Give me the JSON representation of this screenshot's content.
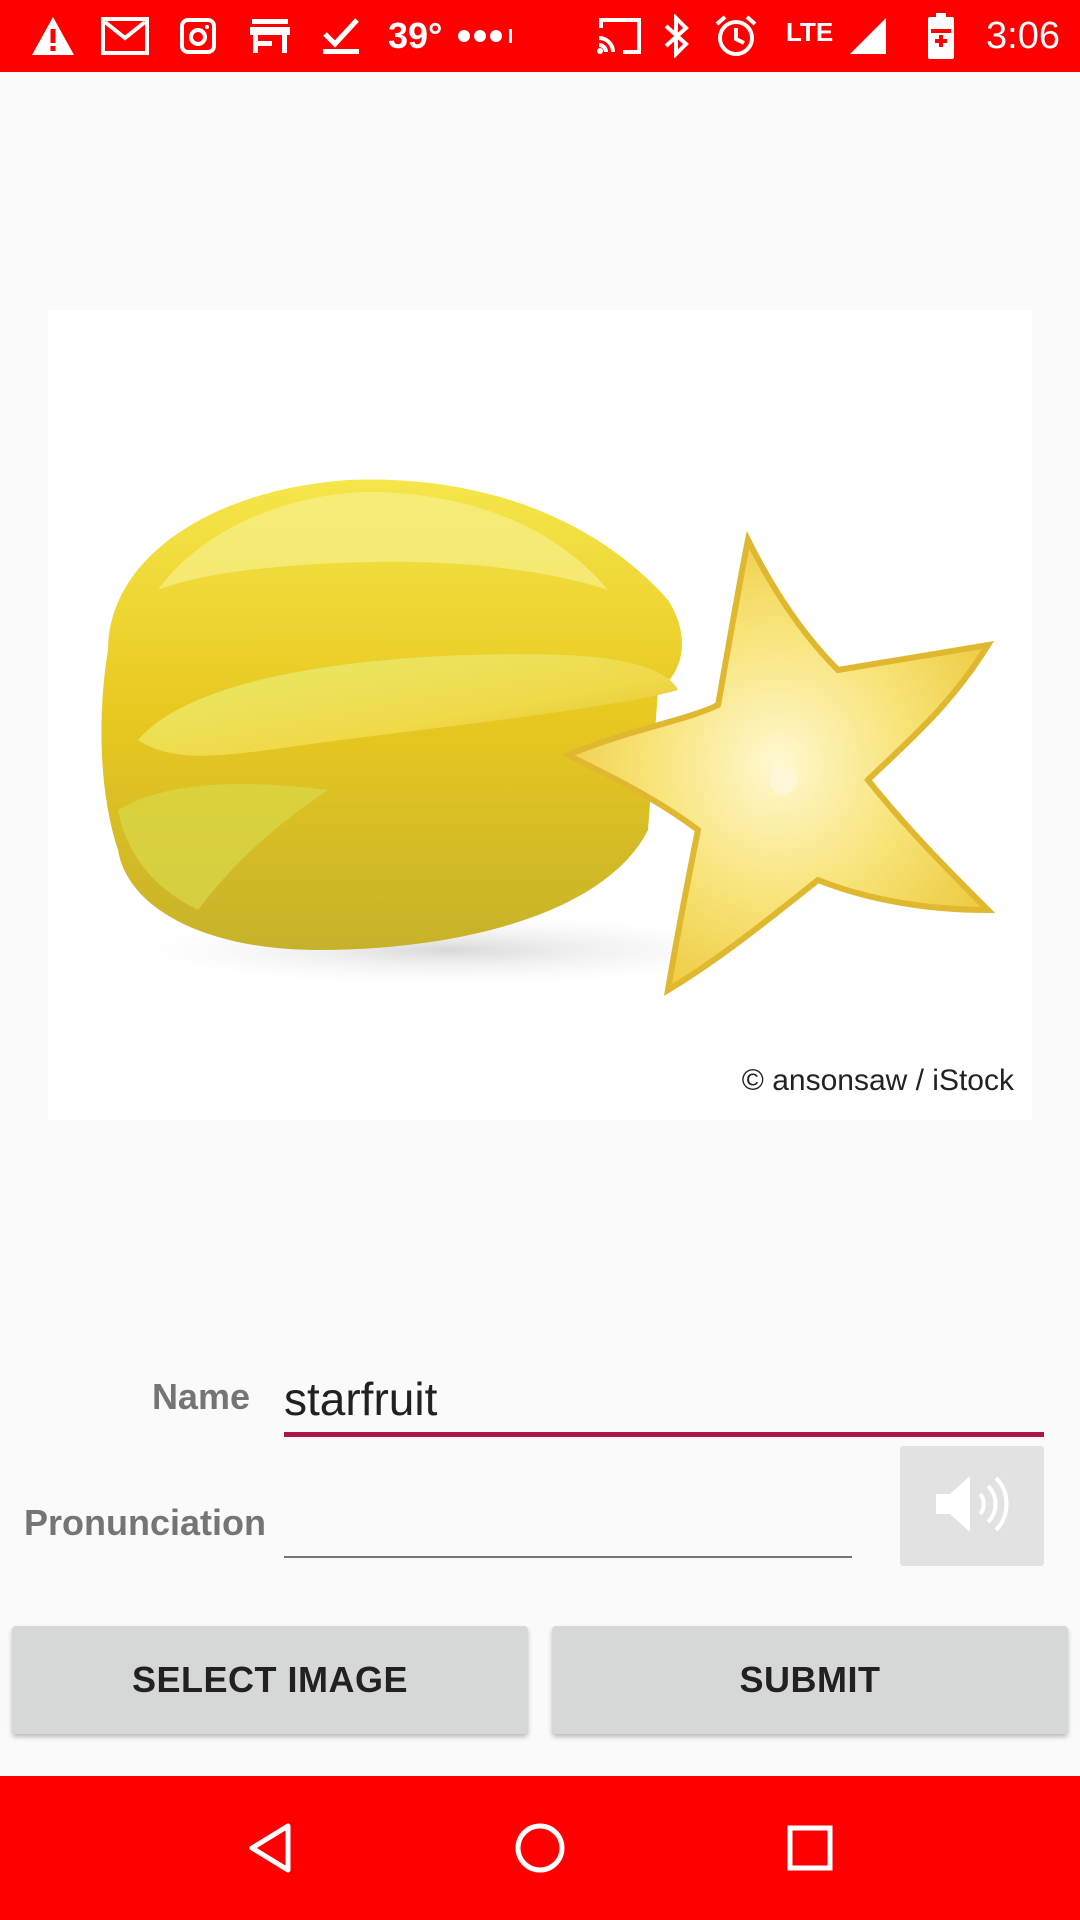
{
  "status_bar": {
    "temperature": "39°",
    "network": "LTE",
    "time": "3:06",
    "icons": [
      "alert-icon",
      "gmail-icon",
      "camera-icon",
      "store-icon",
      "check-icon",
      "more-dots-icon",
      "cast-icon",
      "bluetooth-icon",
      "alarm-icon",
      "signal-icon",
      "battery-icon"
    ]
  },
  "image": {
    "credit": "© ansonsaw / iStock"
  },
  "form": {
    "name_label": "Name",
    "name_value": "starfruit",
    "pronunciation_label": "Pronunciation",
    "pronunciation_value": "",
    "speaker_icon": "speaker-icon"
  },
  "buttons": {
    "select_image": "SELECT IMAGE",
    "submit": "SUBMIT"
  },
  "nav": {
    "icons": [
      "back-icon",
      "home-icon",
      "recents-icon"
    ]
  },
  "colors": {
    "status_bar": "#ff0000",
    "accent_underline": "#b0154a",
    "button_bg": "#d6d7d7"
  }
}
